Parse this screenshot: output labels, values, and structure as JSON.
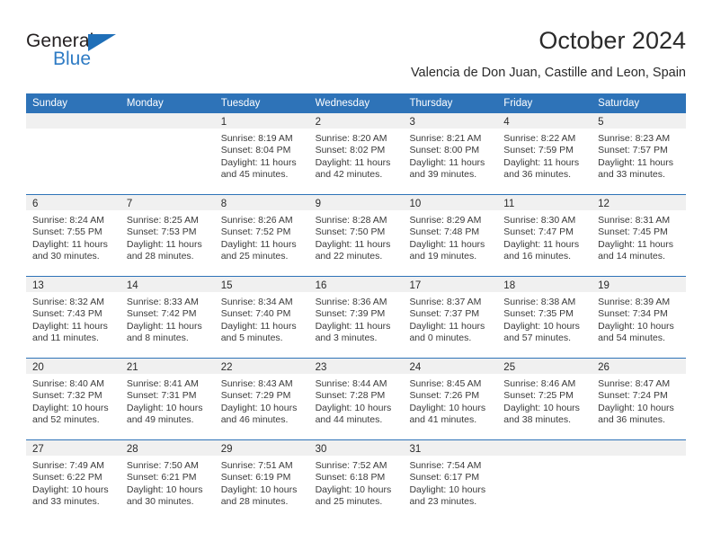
{
  "brand": {
    "name_top": "General",
    "name_bottom": "Blue",
    "accent_color": "#2e7bc4",
    "triangle_icon": "blue-triangle-icon"
  },
  "header": {
    "title": "October 2024",
    "subtitle": "Valencia de Don Juan, Castille and Leon, Spain"
  },
  "theme": {
    "header_blue": "#2e73b8",
    "day_band_gray": "#f0f0f0",
    "text_color": "#2a2a2a"
  },
  "weekdays": [
    "Sunday",
    "Monday",
    "Tuesday",
    "Wednesday",
    "Thursday",
    "Friday",
    "Saturday"
  ],
  "labels": {
    "sunrise": "Sunrise:",
    "sunset": "Sunset:",
    "daylight": "Daylight:"
  },
  "weeks": [
    [
      {
        "day": "",
        "empty": true
      },
      {
        "day": "",
        "empty": true
      },
      {
        "day": "1",
        "sunrise": "Sunrise: 8:19 AM",
        "sunset": "Sunset: 8:04 PM",
        "daylight_1": "Daylight: 11 hours",
        "daylight_2": "and 45 minutes."
      },
      {
        "day": "2",
        "sunrise": "Sunrise: 8:20 AM",
        "sunset": "Sunset: 8:02 PM",
        "daylight_1": "Daylight: 11 hours",
        "daylight_2": "and 42 minutes."
      },
      {
        "day": "3",
        "sunrise": "Sunrise: 8:21 AM",
        "sunset": "Sunset: 8:00 PM",
        "daylight_1": "Daylight: 11 hours",
        "daylight_2": "and 39 minutes."
      },
      {
        "day": "4",
        "sunrise": "Sunrise: 8:22 AM",
        "sunset": "Sunset: 7:59 PM",
        "daylight_1": "Daylight: 11 hours",
        "daylight_2": "and 36 minutes."
      },
      {
        "day": "5",
        "sunrise": "Sunrise: 8:23 AM",
        "sunset": "Sunset: 7:57 PM",
        "daylight_1": "Daylight: 11 hours",
        "daylight_2": "and 33 minutes."
      }
    ],
    [
      {
        "day": "6",
        "sunrise": "Sunrise: 8:24 AM",
        "sunset": "Sunset: 7:55 PM",
        "daylight_1": "Daylight: 11 hours",
        "daylight_2": "and 30 minutes."
      },
      {
        "day": "7",
        "sunrise": "Sunrise: 8:25 AM",
        "sunset": "Sunset: 7:53 PM",
        "daylight_1": "Daylight: 11 hours",
        "daylight_2": "and 28 minutes."
      },
      {
        "day": "8",
        "sunrise": "Sunrise: 8:26 AM",
        "sunset": "Sunset: 7:52 PM",
        "daylight_1": "Daylight: 11 hours",
        "daylight_2": "and 25 minutes."
      },
      {
        "day": "9",
        "sunrise": "Sunrise: 8:28 AM",
        "sunset": "Sunset: 7:50 PM",
        "daylight_1": "Daylight: 11 hours",
        "daylight_2": "and 22 minutes."
      },
      {
        "day": "10",
        "sunrise": "Sunrise: 8:29 AM",
        "sunset": "Sunset: 7:48 PM",
        "daylight_1": "Daylight: 11 hours",
        "daylight_2": "and 19 minutes."
      },
      {
        "day": "11",
        "sunrise": "Sunrise: 8:30 AM",
        "sunset": "Sunset: 7:47 PM",
        "daylight_1": "Daylight: 11 hours",
        "daylight_2": "and 16 minutes."
      },
      {
        "day": "12",
        "sunrise": "Sunrise: 8:31 AM",
        "sunset": "Sunset: 7:45 PM",
        "daylight_1": "Daylight: 11 hours",
        "daylight_2": "and 14 minutes."
      }
    ],
    [
      {
        "day": "13",
        "sunrise": "Sunrise: 8:32 AM",
        "sunset": "Sunset: 7:43 PM",
        "daylight_1": "Daylight: 11 hours",
        "daylight_2": "and 11 minutes."
      },
      {
        "day": "14",
        "sunrise": "Sunrise: 8:33 AM",
        "sunset": "Sunset: 7:42 PM",
        "daylight_1": "Daylight: 11 hours",
        "daylight_2": "and 8 minutes."
      },
      {
        "day": "15",
        "sunrise": "Sunrise: 8:34 AM",
        "sunset": "Sunset: 7:40 PM",
        "daylight_1": "Daylight: 11 hours",
        "daylight_2": "and 5 minutes."
      },
      {
        "day": "16",
        "sunrise": "Sunrise: 8:36 AM",
        "sunset": "Sunset: 7:39 PM",
        "daylight_1": "Daylight: 11 hours",
        "daylight_2": "and 3 minutes."
      },
      {
        "day": "17",
        "sunrise": "Sunrise: 8:37 AM",
        "sunset": "Sunset: 7:37 PM",
        "daylight_1": "Daylight: 11 hours",
        "daylight_2": "and 0 minutes."
      },
      {
        "day": "18",
        "sunrise": "Sunrise: 8:38 AM",
        "sunset": "Sunset: 7:35 PM",
        "daylight_1": "Daylight: 10 hours",
        "daylight_2": "and 57 minutes."
      },
      {
        "day": "19",
        "sunrise": "Sunrise: 8:39 AM",
        "sunset": "Sunset: 7:34 PM",
        "daylight_1": "Daylight: 10 hours",
        "daylight_2": "and 54 minutes."
      }
    ],
    [
      {
        "day": "20",
        "sunrise": "Sunrise: 8:40 AM",
        "sunset": "Sunset: 7:32 PM",
        "daylight_1": "Daylight: 10 hours",
        "daylight_2": "and 52 minutes."
      },
      {
        "day": "21",
        "sunrise": "Sunrise: 8:41 AM",
        "sunset": "Sunset: 7:31 PM",
        "daylight_1": "Daylight: 10 hours",
        "daylight_2": "and 49 minutes."
      },
      {
        "day": "22",
        "sunrise": "Sunrise: 8:43 AM",
        "sunset": "Sunset: 7:29 PM",
        "daylight_1": "Daylight: 10 hours",
        "daylight_2": "and 46 minutes."
      },
      {
        "day": "23",
        "sunrise": "Sunrise: 8:44 AM",
        "sunset": "Sunset: 7:28 PM",
        "daylight_1": "Daylight: 10 hours",
        "daylight_2": "and 44 minutes."
      },
      {
        "day": "24",
        "sunrise": "Sunrise: 8:45 AM",
        "sunset": "Sunset: 7:26 PM",
        "daylight_1": "Daylight: 10 hours",
        "daylight_2": "and 41 minutes."
      },
      {
        "day": "25",
        "sunrise": "Sunrise: 8:46 AM",
        "sunset": "Sunset: 7:25 PM",
        "daylight_1": "Daylight: 10 hours",
        "daylight_2": "and 38 minutes."
      },
      {
        "day": "26",
        "sunrise": "Sunrise: 8:47 AM",
        "sunset": "Sunset: 7:24 PM",
        "daylight_1": "Daylight: 10 hours",
        "daylight_2": "and 36 minutes."
      }
    ],
    [
      {
        "day": "27",
        "sunrise": "Sunrise: 7:49 AM",
        "sunset": "Sunset: 6:22 PM",
        "daylight_1": "Daylight: 10 hours",
        "daylight_2": "and 33 minutes."
      },
      {
        "day": "28",
        "sunrise": "Sunrise: 7:50 AM",
        "sunset": "Sunset: 6:21 PM",
        "daylight_1": "Daylight: 10 hours",
        "daylight_2": "and 30 minutes."
      },
      {
        "day": "29",
        "sunrise": "Sunrise: 7:51 AM",
        "sunset": "Sunset: 6:19 PM",
        "daylight_1": "Daylight: 10 hours",
        "daylight_2": "and 28 minutes."
      },
      {
        "day": "30",
        "sunrise": "Sunrise: 7:52 AM",
        "sunset": "Sunset: 6:18 PM",
        "daylight_1": "Daylight: 10 hours",
        "daylight_2": "and 25 minutes."
      },
      {
        "day": "31",
        "sunrise": "Sunrise: 7:54 AM",
        "sunset": "Sunset: 6:17 PM",
        "daylight_1": "Daylight: 10 hours",
        "daylight_2": "and 23 minutes."
      },
      {
        "day": "",
        "empty": true
      },
      {
        "day": "",
        "empty": true
      }
    ]
  ]
}
